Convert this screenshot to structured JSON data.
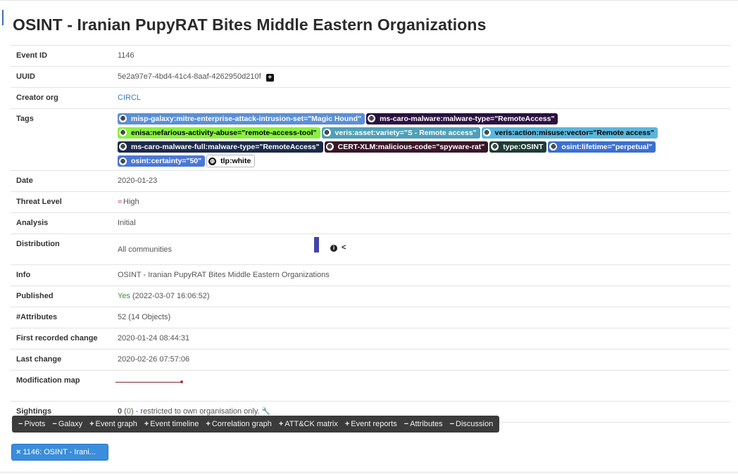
{
  "page": {
    "title": "OSINT - Iranian PupyRAT Bites Middle Eastern Organizations"
  },
  "fields": {
    "event_id": {
      "label": "Event ID",
      "value": "1146"
    },
    "uuid": {
      "label": "UUID",
      "value": "5e2a97e7-4bd4-41c4-8aaf-4262950d210f",
      "copy_icon": "plus-square-icon",
      "copy_glyph": "+"
    },
    "creator_org": {
      "label": "Creator org",
      "value": "CIRCL"
    },
    "tags": {
      "label": "Tags"
    },
    "date": {
      "label": "Date",
      "value": "2020-01-23"
    },
    "threat_level": {
      "label": "Threat Level",
      "value": "High",
      "icon": "chevron-double-up-icon",
      "glyph": "≈"
    },
    "analysis": {
      "label": "Analysis",
      "value": "Initial"
    },
    "distribution": {
      "label": "Distribution",
      "value": "All communities",
      "info_glyph": "i",
      "share_glyph": "<"
    },
    "info": {
      "label": "Info",
      "value": "OSINT - Iranian PupyRAT Bites Middle Eastern Organizations"
    },
    "published": {
      "label": "Published",
      "value": "Yes",
      "timestamp": "(2022-03-07 16:06:52)"
    },
    "attributes": {
      "label": "#Attributes",
      "value": "52 (14 Objects)"
    },
    "first_change": {
      "label": "First recorded change",
      "value": "2020-01-24 08:44:31"
    },
    "last_change": {
      "label": "Last change",
      "value": "2020-02-26 07:57:06"
    },
    "modification_map": {
      "label": "Modification map"
    },
    "sightings": {
      "label": "Sightings",
      "count": "0",
      "paren_open": " (",
      "count_link": "0",
      "paren_close": ")",
      "note": " - restricted to own organisation only.",
      "icon": "wrench-icon",
      "glyph": "🔧"
    }
  },
  "tags": [
    {
      "text": "misp-galaxy:mitre-enterprise-attack-intrusion-set=\"Magic Hound\"",
      "bg": "#5b8fd6",
      "fg": "#ffffff"
    },
    {
      "text": "ms-caro-malware:malware-type=\"RemoteAccess\"",
      "bg": "#2c1040",
      "fg": "#ffffff"
    },
    {
      "text": "enisa:nefarious-activity-abuse=\"remote-access-tool\"",
      "bg": "#88f23c",
      "fg": "#000000"
    },
    {
      "text": "veris:asset:variety=\"S - Remote access\"",
      "bg": "#4f9fb8",
      "fg": "#ffffff"
    },
    {
      "text": "veris:action:misuse:vector=\"Remote access\"",
      "bg": "#5ab6dc",
      "fg": "#000000"
    },
    {
      "text": "ms-caro-malware-full:malware-type=\"RemoteAccess\"",
      "bg": "#1c2a4a",
      "fg": "#ffffff"
    },
    {
      "text": "CERT-XLM:malicious-code=\"spyware-rat\"",
      "bg": "#3a1628",
      "fg": "#ffffff"
    },
    {
      "text": "type:OSINT",
      "bg": "#1f3c35",
      "fg": "#ffffff"
    },
    {
      "text": "osint:lifetime=\"perpetual\"",
      "bg": "#3c6fd0",
      "fg": "#ffffff"
    },
    {
      "text": "osint:certainty=\"50\"",
      "bg": "#4a78d8",
      "fg": "#ffffff"
    },
    {
      "text": "tlp:white",
      "bg": "#ffffff",
      "fg": "#000000",
      "bordered": true
    }
  ],
  "tag_globe_glyph": "⊕",
  "toolbar": [
    {
      "sym": "−",
      "label": "Pivots"
    },
    {
      "sym": "−",
      "label": "Galaxy"
    },
    {
      "sym": "+",
      "label": "Event graph"
    },
    {
      "sym": "+",
      "label": "Event timeline"
    },
    {
      "sym": "+",
      "label": "Correlation graph"
    },
    {
      "sym": "+",
      "label": "ATT&CK matrix"
    },
    {
      "sym": "+",
      "label": "Event reports"
    },
    {
      "sym": "−",
      "label": "Attributes"
    },
    {
      "sym": "−",
      "label": "Discussion"
    }
  ],
  "event_chip": {
    "close": "×",
    "label": "1146: OSINT - Irani..."
  }
}
